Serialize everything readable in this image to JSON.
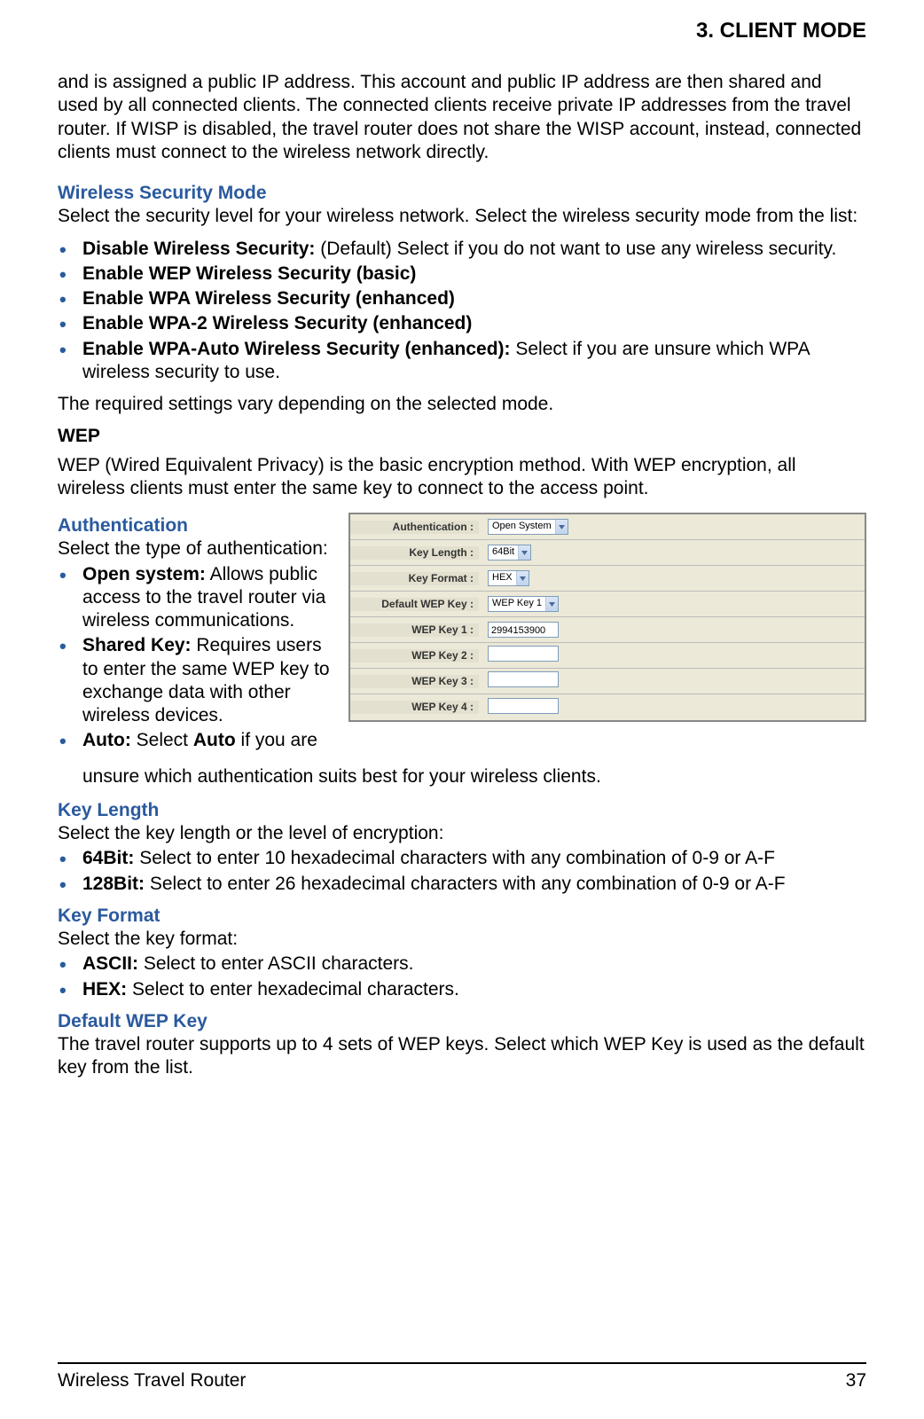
{
  "header": {
    "chapter": "3.  CLIENT MODE"
  },
  "intro_para": "and is assigned a public IP address. This account and public IP address are then shared and used by all  connected clients. The connected clients receive private IP addresses from the travel router. If WISP is disabled, the travel router does not share the WISP account, instead, connected clients must connect to the wireless network directly.",
  "wireless_security_mode": {
    "heading": "Wireless Security Mode",
    "desc": "Select the security level for your wireless network. Select the wireless security mode from the list:",
    "items": [
      {
        "bold": "Disable Wireless Security:",
        "rest": " (Default) Select if you do not want to use any wireless security."
      },
      {
        "bold": "Enable WEP Wireless Security (basic)",
        "rest": ""
      },
      {
        "bold": "Enable WPA Wireless Security (enhanced)",
        "rest": ""
      },
      {
        "bold": "Enable WPA-2 Wireless Security (enhanced)",
        "rest": ""
      },
      {
        "bold": "Enable WPA-Auto Wireless Security (enhanced):",
        "rest": " Select if you are unsure which WPA wireless security to use."
      }
    ],
    "after": "The required settings vary depending on the selected mode."
  },
  "wep": {
    "title": "WEP",
    "desc": "WEP (Wired Equivalent Privacy) is the basic encryption method. With WEP encryption, all wireless clients must enter the same key to connect to the access point."
  },
  "authentication": {
    "heading": "Authentication",
    "intro": "Select the type of authentication:",
    "items": [
      {
        "bold": "Open system:",
        "rest": " Allows public access to the travel router via wireless communications."
      },
      {
        "bold": "Shared Key:",
        "rest": " Requires users to enter the same WEP key to exchange data with other wireless devices."
      }
    ],
    "auto_item": {
      "bold_pre": "Auto:",
      "mid": " Select ",
      "bold_mid": "Auto",
      "rest": " if you are"
    },
    "auto_cont": "unsure which authentication suits best for your wireless clients."
  },
  "config_panel": {
    "rows": [
      {
        "label": "Authentication :",
        "type": "select",
        "value": "Open System"
      },
      {
        "label": "Key Length :",
        "type": "select",
        "value": "64Bit"
      },
      {
        "label": "Key Format :",
        "type": "select",
        "value": "HEX"
      },
      {
        "label": "Default WEP Key :",
        "type": "select",
        "value": "WEP Key 1"
      },
      {
        "label": "WEP Key 1 :",
        "type": "input",
        "value": "2994153900"
      },
      {
        "label": "WEP Key 2 :",
        "type": "input",
        "value": ""
      },
      {
        "label": "WEP Key 3 :",
        "type": "input",
        "value": ""
      },
      {
        "label": "WEP Key 4 :",
        "type": "input",
        "value": ""
      }
    ]
  },
  "key_length": {
    "heading": "Key Length",
    "intro": "Select the key length or the level of encryption:",
    "items": [
      {
        "bold": "64Bit:",
        "rest": " Select to enter 10 hexadecimal characters with any combination of 0-9 or A-F"
      },
      {
        "bold": "128Bit:",
        "rest": " Select to enter 26 hexadecimal characters with any combination of 0-9 or A-F"
      }
    ]
  },
  "key_format": {
    "heading": "Key Format",
    "intro": "Select the key format:",
    "items": [
      {
        "bold": "ASCII:",
        "rest": " Select to enter ASCII characters."
      },
      {
        "bold": "HEX:",
        "rest": " Select to enter hexadecimal characters."
      }
    ]
  },
  "default_wep_key": {
    "heading": "Default WEP Key",
    "desc": "The travel router supports up to 4 sets of WEP keys. Select which WEP Key is used as the default key from the list."
  },
  "footer": {
    "left": "Wireless Travel Router",
    "right": "37"
  }
}
